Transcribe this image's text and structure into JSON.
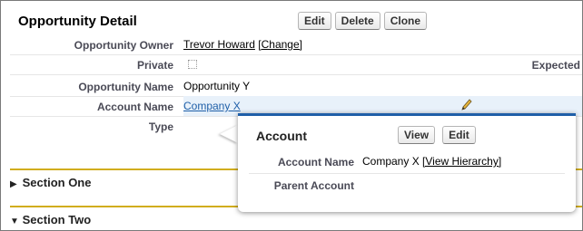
{
  "detail": {
    "title": "Opportunity Detail",
    "buttons": {
      "edit": "Edit",
      "delete": "Delete",
      "clone": "Clone"
    }
  },
  "fields": {
    "owner": {
      "label": "Opportunity Owner",
      "value": "Trevor Howard",
      "change_link": "[Change]"
    },
    "private": {
      "label": "Private",
      "checked": false,
      "right_label": "Expected"
    },
    "name": {
      "label": "Opportunity Name",
      "value": "Opportunity Y"
    },
    "account": {
      "label": "Account Name",
      "value": "Company X"
    },
    "type": {
      "label": "Type",
      "value": ""
    }
  },
  "sections": {
    "one": {
      "label": "Section One",
      "expanded": false
    },
    "two": {
      "label": "Section Two",
      "expanded": true
    }
  },
  "popup": {
    "title": "Account",
    "buttons": {
      "view": "View",
      "edit": "Edit"
    },
    "account_name": {
      "label": "Account Name",
      "value": "Company X",
      "hierarchy_link": "[View Hierarchy]"
    },
    "parent_account": {
      "label": "Parent Account",
      "value": ""
    }
  },
  "colors": {
    "section_rule": "#d1ad1e",
    "popup_accent": "#1f5fa8",
    "hover_row": "#e8f1fa"
  },
  "icons": {
    "edit_pencil": "pencil-icon",
    "collapsed": "triangle-right-icon",
    "expanded": "triangle-down-icon"
  }
}
